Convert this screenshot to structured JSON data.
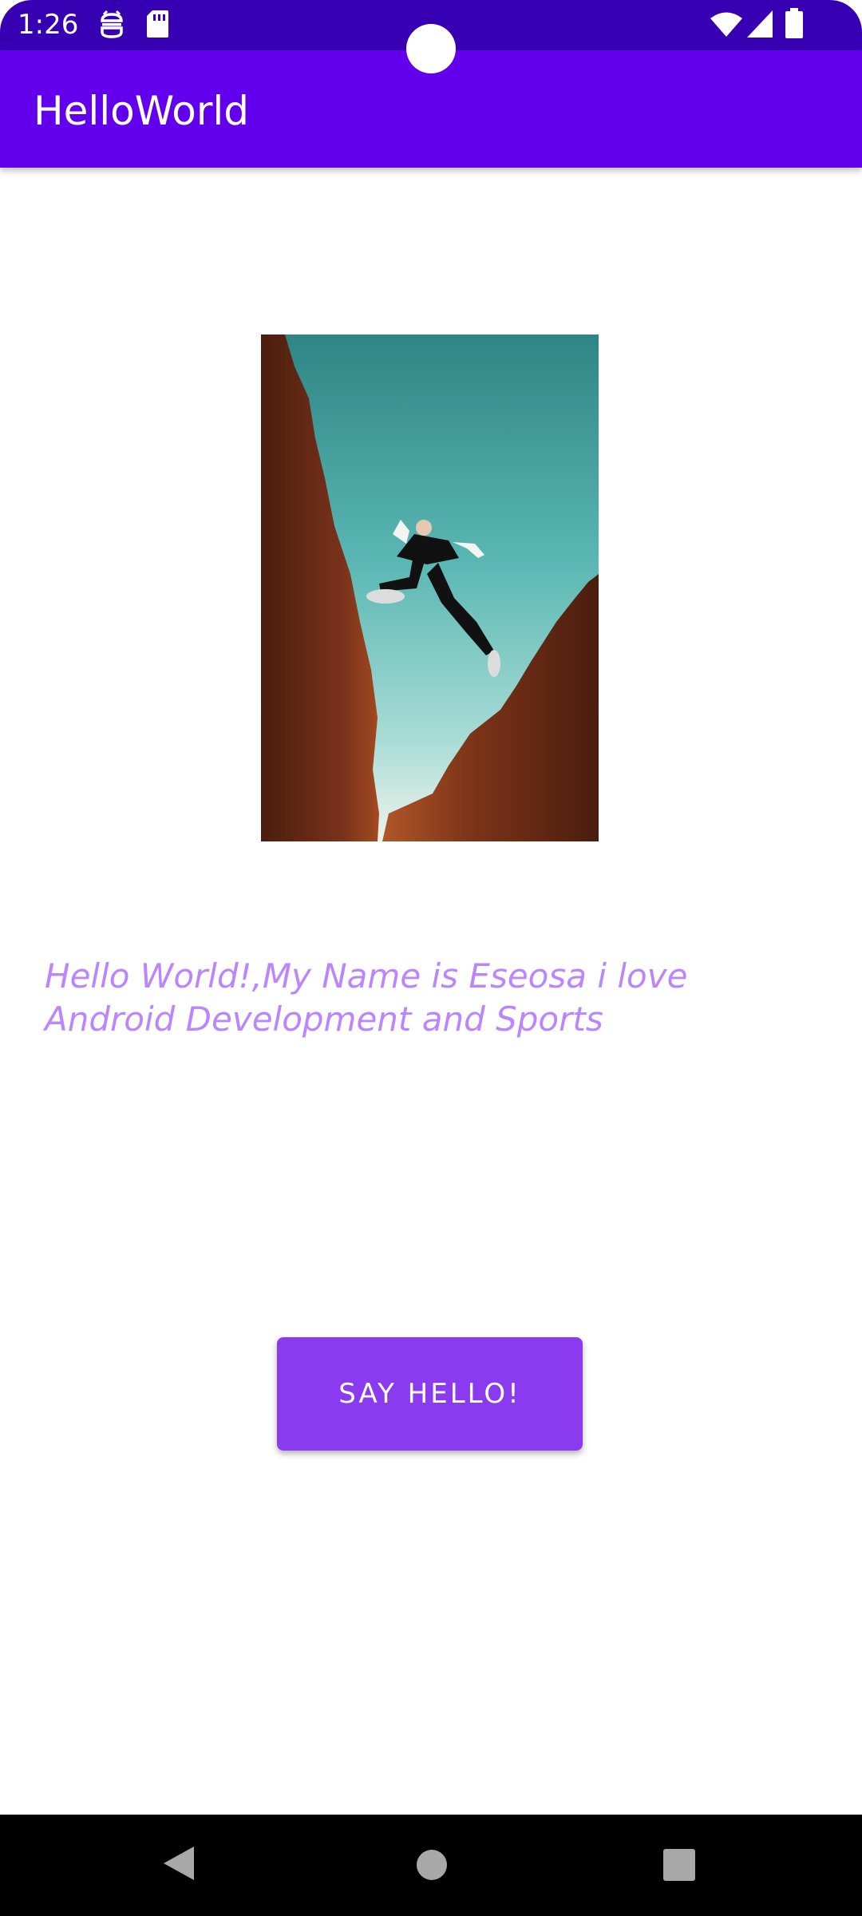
{
  "status_bar": {
    "time": "1:26",
    "left_icons": [
      "android-debug-icon",
      "sd-card-icon"
    ],
    "right_icons": [
      "wifi-icon",
      "cellular-signal-icon",
      "battery-icon"
    ],
    "background_color": "#3700b3"
  },
  "app_bar": {
    "title": "HelloWorld",
    "background_color": "#6200ee"
  },
  "main": {
    "hero_image": "person-jumping-between-cliffs-photo",
    "intro_text": "Hello World!,My Name is Eseosa i love Android Development and Sports",
    "intro_text_color": "#bb86fc",
    "button_label": "SAY HELLO!",
    "button_color": "#8a3bf0"
  },
  "nav_bar": {
    "buttons": [
      "back-icon",
      "home-icon",
      "recents-icon"
    ]
  }
}
